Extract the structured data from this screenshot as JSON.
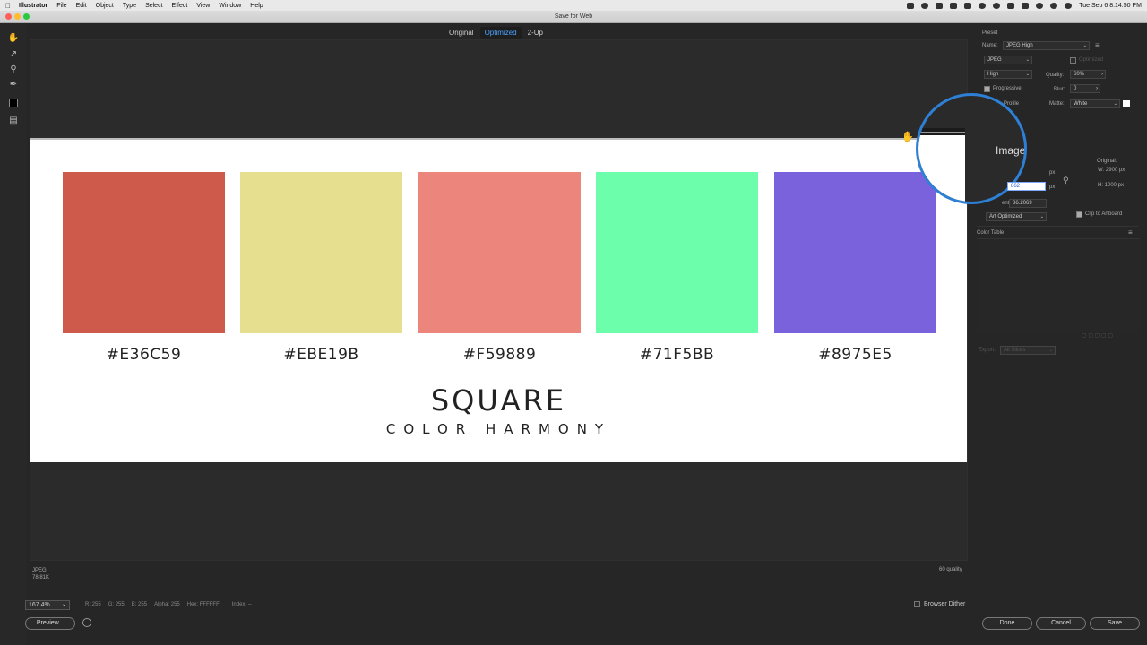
{
  "menubar": {
    "app": "Illustrator",
    "menus": [
      "File",
      "Edit",
      "Object",
      "Type",
      "Select",
      "Effect",
      "View",
      "Window",
      "Help"
    ],
    "clock": "Tue Sep 6  8:14:50 PM"
  },
  "window": {
    "title": "Save for Web"
  },
  "view_tabs": [
    "Original",
    "Optimized",
    "2-Up"
  ],
  "active_tab": "Optimized",
  "artboard": {
    "swatches": [
      {
        "hex": "#E36C59",
        "color": "#CE5A4B"
      },
      {
        "hex": "#EBE19B",
        "color": "#E5DF8F"
      },
      {
        "hex": "#F59889",
        "color": "#EC857C"
      },
      {
        "hex": "#71F5BB",
        "color": "#6CFEAB"
      },
      {
        "hex": "#8975E5",
        "color": "#7B62DD"
      }
    ],
    "title": "SQUARE",
    "subtitle": "COLOR HARMONY"
  },
  "canvas_info": {
    "format": "JPEG",
    "size": "78.81K",
    "quality": "60 quality"
  },
  "bottom": {
    "zoom": "167.4%",
    "pixel": {
      "r": "R: 255",
      "g": "G: 255",
      "b": "B: 255",
      "alpha": "Alpha: 255",
      "hex": "Hex: FFFFFF",
      "index": "Index: --"
    },
    "browser_dither": "Browser Dither",
    "preview": "Preview...",
    "done": "Done",
    "cancel": "Cancel",
    "save": "Save"
  },
  "panel": {
    "preset_label": "Preset",
    "name_label": "Name:",
    "name_value": "JPEG High",
    "format": "JPEG",
    "optimized_label": "Optimized",
    "compression": "High",
    "quality_label": "Quality:",
    "quality_value": "60%",
    "progressive_label": "Progressive",
    "blur_label": "Blur:",
    "blur_value": "0",
    "profile_label": "Profile",
    "matte_label": "Matte:",
    "matte_value": "White",
    "image_label": "Image",
    "original_label": "Original:",
    "width_label": "W: 2900 px",
    "height_label": "H: 1000 px",
    "percent_label": "ent:",
    "percent_value": "86.2069",
    "px_unit": "px",
    "selected_field": "862",
    "resample": "Art Optimized",
    "clip_label": "Clip to Artboard",
    "color_table_label": "Color Table",
    "export_label": "Export:",
    "export_value": "All Slices"
  }
}
